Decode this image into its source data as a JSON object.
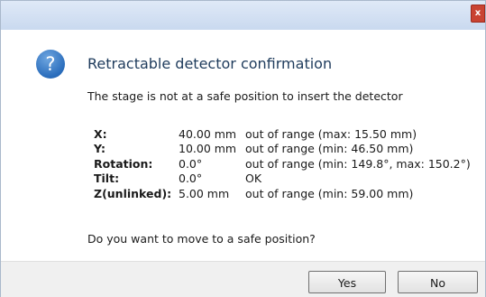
{
  "window": {
    "close_glyph": "x"
  },
  "dialog": {
    "icon": "question-icon",
    "icon_glyph": "?",
    "heading": "Retractable detector confirmation",
    "message": "The stage is not at a safe position to insert the detector",
    "rows": [
      {
        "label": "X:",
        "value": "40.00 mm",
        "status": "out of range (max: 15.50 mm)"
      },
      {
        "label": "Y:",
        "value": "10.00 mm",
        "status": "out of range (min: 46.50 mm)"
      },
      {
        "label": "Rotation:",
        "value": "0.0°",
        "status": "out of range (min: 149.8°, max: 150.2°)"
      },
      {
        "label": "Tilt:",
        "value": "0.0°",
        "status": "OK"
      },
      {
        "label": "Z(unlinked):",
        "value": "5.00 mm",
        "status": "out of range (min: 59.00 mm)"
      }
    ],
    "question": "Do you want to move to a safe position?"
  },
  "buttons": {
    "yes": "Yes",
    "no": "No"
  },
  "colors": {
    "heading": "#1e3b5c",
    "icon": "#2a6dbc",
    "close": "#c94332"
  }
}
